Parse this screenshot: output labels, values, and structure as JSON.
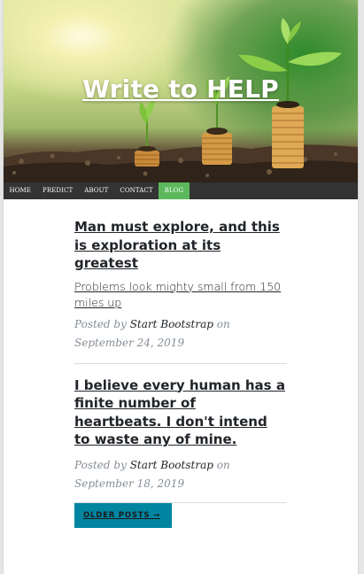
{
  "site": {
    "title": "Write to HELP"
  },
  "nav": {
    "items": [
      {
        "label": "HOME"
      },
      {
        "label": "PREDICT"
      },
      {
        "label": "ABOUT"
      },
      {
        "label": "CONTACT"
      },
      {
        "label": "BLOG"
      }
    ],
    "active_item": "BLOG",
    "active_color": "#5cb85c",
    "bar_color": "#333333"
  },
  "posts": [
    {
      "title": "Man must explore, and this is exploration at its greatest",
      "subtitle": "Problems look mighty small from 150 miles up",
      "meta_prefix": "Posted by",
      "author": "Start Bootstrap",
      "meta_on": "on",
      "date": "September 24, 2019"
    },
    {
      "title": "I believe every human has a finite number of heartbeats. I don't intend to waste any of mine.",
      "subtitle": "",
      "meta_prefix": "Posted by",
      "author": "Start Bootstrap",
      "meta_on": "on",
      "date": "September 18, 2019"
    }
  ],
  "pager": {
    "older_label": "OLDER POSTS →",
    "button_color": "#0085a1"
  },
  "hero": {
    "image_description_icon": "plant-coins-image"
  }
}
